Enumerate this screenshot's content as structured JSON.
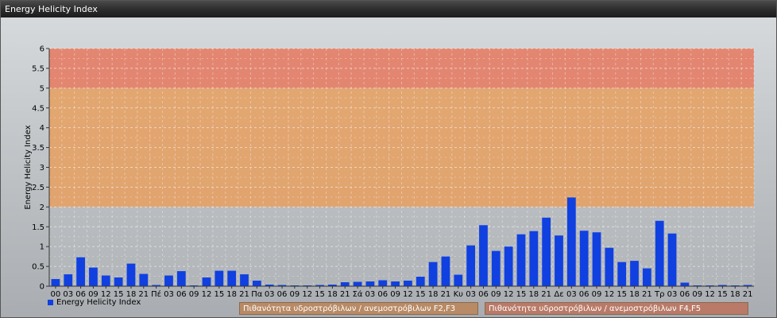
{
  "window": {
    "title": "Energy Helicity Index"
  },
  "chart_data": {
    "type": "bar",
    "title": "",
    "ylabel": "Energy Helicity Index",
    "xlabel": "",
    "ylim": [
      0,
      6
    ],
    "yticks": [
      "0",
      "0.5",
      "1",
      "1.5",
      "2",
      "2.5",
      "3",
      "3.5",
      "4",
      "4.5",
      "5",
      "5.5",
      "6"
    ],
    "grid": true,
    "legend_position": "bottom-left",
    "categories": [
      "00",
      "03",
      "06",
      "09",
      "12",
      "15",
      "18",
      "21",
      "Πέ",
      "03",
      "06",
      "09",
      "12",
      "15",
      "18",
      "21",
      "Πα",
      "03",
      "06",
      "09",
      "12",
      "15",
      "18",
      "21",
      "Σά",
      "03",
      "06",
      "09",
      "12",
      "15",
      "18",
      "21",
      "Κυ",
      "03",
      "06",
      "09",
      "12",
      "15",
      "18",
      "21",
      "Δε",
      "03",
      "06",
      "09",
      "12",
      "15",
      "18",
      "21",
      "Τρ",
      "03",
      "06",
      "09",
      "12",
      "15",
      "18",
      "21"
    ],
    "series": [
      {
        "name": "Energy Helicity Index",
        "color": "#1040e0",
        "values": [
          0.18,
          0.3,
          0.73,
          0.47,
          0.27,
          0.22,
          0.57,
          0.31,
          0.03,
          0.27,
          0.38,
          0.02,
          0.22,
          0.39,
          0.39,
          0.3,
          0.14,
          0.04,
          0.03,
          0.02,
          0.02,
          0.03,
          0.04,
          0.1,
          0.11,
          0.12,
          0.15,
          0.12,
          0.14,
          0.24,
          0.61,
          0.75,
          0.29,
          1.03,
          1.54,
          0.89,
          1.0,
          1.31,
          1.39,
          1.73,
          1.28,
          2.24,
          1.4,
          1.36,
          0.97,
          0.61,
          0.64,
          0.45,
          1.65,
          1.33,
          0.09,
          0.02,
          0.02,
          0.03,
          0.02,
          0.03
        ]
      }
    ],
    "bands": [
      {
        "from": 2,
        "to": 5,
        "color": "#e8a060",
        "label": "Πιθανότητα υδροστρόβιλων / ανεμοστρόβιλων F2,F3"
      },
      {
        "from": 5,
        "to": 6,
        "color": "#e87a60",
        "label": "Πιθανότητα υδροστρόβιλων / ανεμοστρόβιλων F4,F5"
      }
    ]
  }
}
